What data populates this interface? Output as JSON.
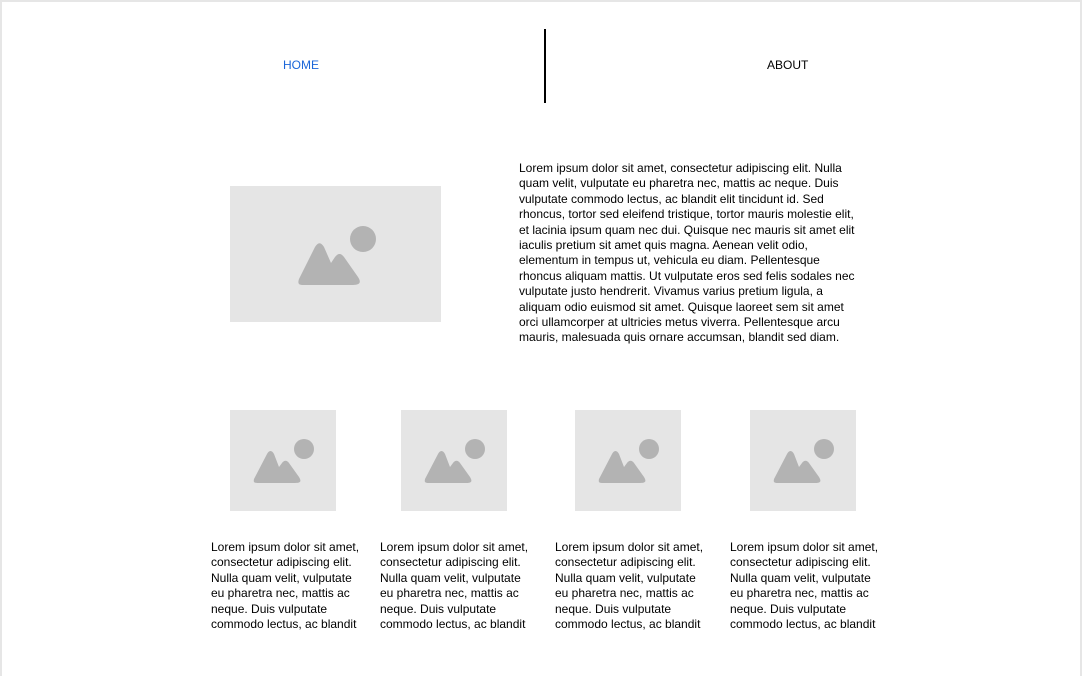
{
  "nav": {
    "home_label": "HOME",
    "about_label": "ABOUT",
    "active_color": "#1a66d9",
    "inactive_color": "#000000"
  },
  "icons": {
    "image_placeholder": "image-placeholder-icon",
    "placeholder_bg": "#e5e5e5",
    "placeholder_fg": "#b3b3b3"
  },
  "hero": {
    "text": "Lorem ipsum dolor sit amet, consectetur adipiscing elit. Nulla quam velit, vulputate eu pharetra nec, mattis ac neque. Duis vulputate commodo lectus, ac blandit elit tincidunt id. Sed rhoncus, tortor sed eleifend tristique, tortor mauris molestie elit, et lacinia ipsum quam nec dui. Quisque nec mauris sit amet elit iaculis pretium sit amet quis magna. Aenean velit odio, elementum in tempus ut, vehicula eu diam. Pellentesque rhoncus aliquam mattis. Ut vulputate eros sed felis sodales nec vulputate justo hendrerit. Vivamus varius pretium ligula, a aliquam odio euismod sit amet. Quisque laoreet sem sit amet orci ullamcorper at ultricies metus viverra. Pellentesque arcu mauris, malesuada quis ornare accumsan, blandit sed diam."
  },
  "cards": [
    {
      "text": "Lorem ipsum dolor sit amet, consectetur adipiscing elit. Nulla quam velit, vulputate eu pharetra nec, mattis ac neque. Duis vulputate commodo lectus, ac blandit"
    },
    {
      "text": "Lorem ipsum dolor sit amet, consectetur adipiscing elit. Nulla quam velit, vulputate eu pharetra nec, mattis ac neque. Duis vulputate commodo lectus, ac blandit"
    },
    {
      "text": "Lorem ipsum dolor sit amet, consectetur adipiscing elit. Nulla quam velit, vulputate eu pharetra nec, mattis ac neque. Duis vulputate commodo lectus, ac blandit"
    },
    {
      "text": "Lorem ipsum dolor sit amet, consectetur adipiscing elit. Nulla quam velit, vulputate eu pharetra nec, mattis ac neque. Duis vulputate commodo lectus, ac blandit"
    }
  ]
}
